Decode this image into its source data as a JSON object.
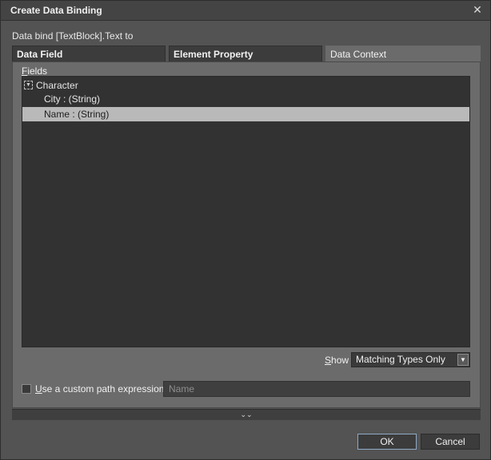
{
  "window": {
    "title": "Create Data Binding",
    "close_glyph": "✕"
  },
  "subtitle": "Data bind [TextBlock].Text to",
  "tabs": [
    {
      "label": "Data Field",
      "selected": false
    },
    {
      "label": "Element Property",
      "selected": false
    },
    {
      "label": "Data Context",
      "selected": true
    }
  ],
  "fields": {
    "label_prefix": "F",
    "label_rest": "ields",
    "tree": [
      {
        "label": "Character",
        "expanded": true,
        "expander_glyph": "▼"
      },
      {
        "label": "City : (String)",
        "selected": false
      },
      {
        "label": "Name : (String)",
        "selected": true
      }
    ]
  },
  "show": {
    "label_prefix": "S",
    "label_rest": "how",
    "selected": "Matching Types Only",
    "arrow_glyph": "▼"
  },
  "custom_path": {
    "label_prefix": "U",
    "label_rest": "se a custom path expression",
    "checked": false,
    "placeholder": "Name"
  },
  "expand_toggle": {
    "glyph": "⌄⌄",
    "icon": "double-chevron-down-icon"
  },
  "buttons": {
    "ok": "OK",
    "cancel": "Cancel"
  },
  "colors": {
    "accent_focus": "#8fa9c6",
    "selection": "#b9b9b9"
  }
}
